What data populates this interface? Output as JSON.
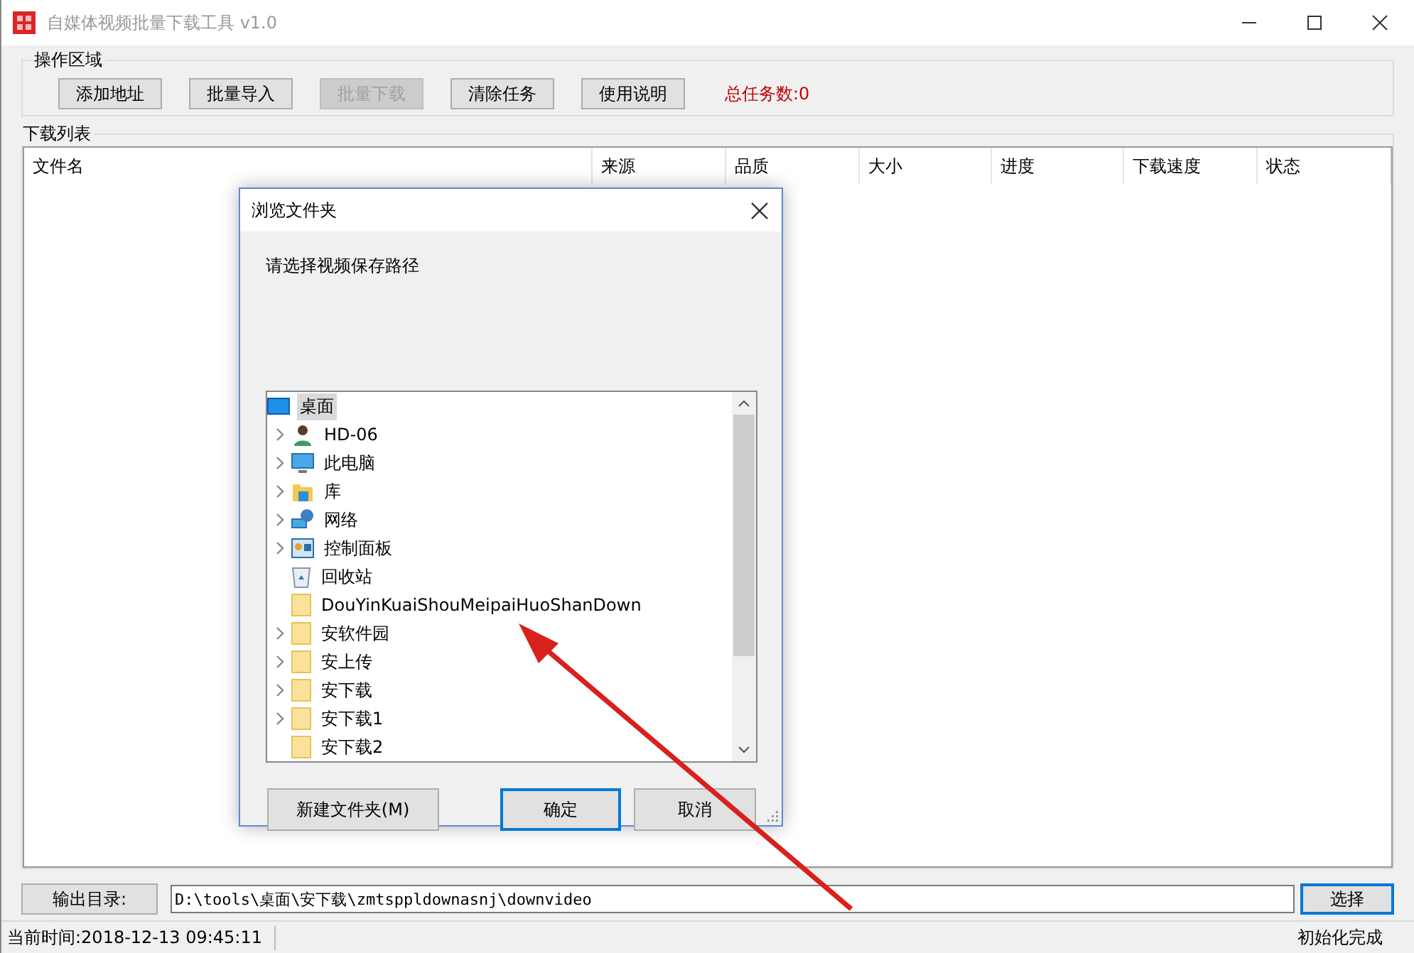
{
  "window": {
    "title": "自媒体视频批量下载工具 v1.0"
  },
  "operations": {
    "title": "操作区域",
    "buttons": [
      {
        "label": "添加地址",
        "disabled": false
      },
      {
        "label": "批量导入",
        "disabled": false
      },
      {
        "label": "批量下载",
        "disabled": true
      },
      {
        "label": "清除任务",
        "disabled": false
      },
      {
        "label": "使用说明",
        "disabled": false
      }
    ],
    "task_count": "总任务数:0"
  },
  "download_list": {
    "title": "下载列表",
    "columns": [
      "文件名",
      "来源",
      "品质",
      "大小",
      "进度",
      "下载速度",
      "状态"
    ]
  },
  "output": {
    "label": "输出目录:",
    "value": "D:\\tools\\桌面\\安下载\\zmtsppldownasnj\\downvideo",
    "button": "选择"
  },
  "status_bar": {
    "time": "当前时间:2018-12-13 09:45:11",
    "message": "初始化完成"
  },
  "dialog": {
    "title": "浏览文件夹",
    "prompt": "请选择视频保存路径",
    "tree": [
      {
        "label": "桌面",
        "kind": "desktop",
        "selected": true,
        "expandable": false,
        "children": [
          {
            "label": "HD-06",
            "kind": "user",
            "selected": false,
            "expandable": true
          },
          {
            "label": "此电脑",
            "kind": "computer",
            "selected": false,
            "expandable": true
          },
          {
            "label": "库",
            "kind": "library",
            "selected": false,
            "expandable": true
          },
          {
            "label": "网络",
            "kind": "network",
            "selected": false,
            "expandable": true
          },
          {
            "label": "控制面板",
            "kind": "control-panel",
            "selected": false,
            "expandable": true
          },
          {
            "label": "回收站",
            "kind": "recycle-bin",
            "selected": false,
            "expandable": false
          },
          {
            "label": "DouYinKuaiShouMeipaiHuoShanDown",
            "kind": "folder",
            "selected": false,
            "expandable": false
          },
          {
            "label": "安软件园",
            "kind": "folder",
            "selected": false,
            "expandable": true
          },
          {
            "label": "安上传",
            "kind": "folder",
            "selected": false,
            "expandable": true
          },
          {
            "label": "安下载",
            "kind": "folder",
            "selected": false,
            "expandable": true
          },
          {
            "label": "安下载1",
            "kind": "folder",
            "selected": false,
            "expandable": true
          },
          {
            "label": "安下载2",
            "kind": "folder",
            "selected": false,
            "expandable": false
          }
        ]
      }
    ],
    "buttons": [
      {
        "label": "新建文件夹(M)",
        "default": false
      },
      {
        "label": "确定",
        "default": true
      },
      {
        "label": "取消",
        "default": false
      }
    ]
  }
}
